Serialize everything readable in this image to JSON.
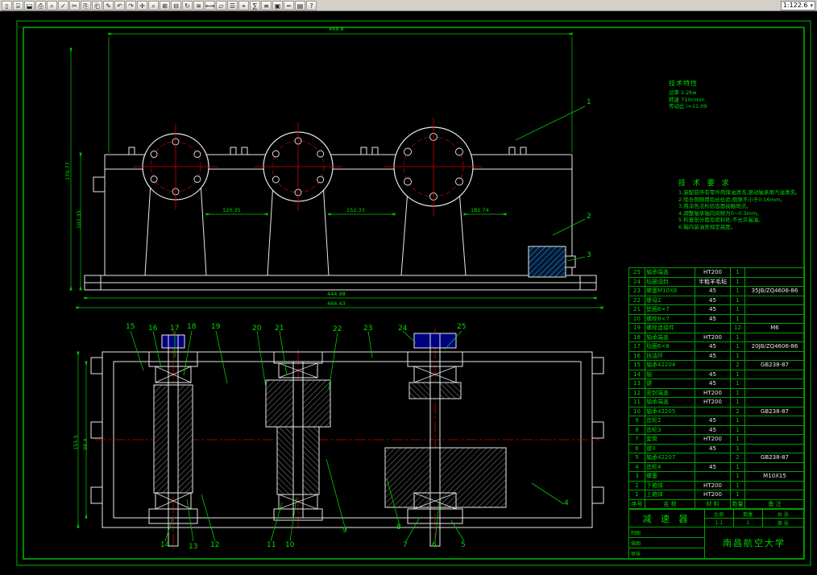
{
  "toolbar": {
    "zoom_value": "1:122.6",
    "icons": [
      {
        "name": "new",
        "glyph": "▯"
      },
      {
        "name": "open",
        "glyph": "⌸"
      },
      {
        "name": "save",
        "glyph": "⬓"
      },
      {
        "name": "print",
        "glyph": "⎙"
      },
      {
        "name": "print-preview",
        "glyph": "⌕"
      },
      {
        "name": "spell-check",
        "glyph": "✓"
      },
      {
        "name": "cut",
        "glyph": "✂"
      },
      {
        "name": "copy",
        "glyph": "⎘"
      },
      {
        "name": "paste",
        "glyph": "⎗"
      },
      {
        "name": "match-properties",
        "glyph": "✎"
      },
      {
        "name": "undo",
        "glyph": "↶"
      },
      {
        "name": "redo",
        "glyph": "↷"
      },
      {
        "name": "pan",
        "glyph": "✛"
      },
      {
        "name": "zoom-realtime",
        "glyph": "⌕"
      },
      {
        "name": "zoom-window",
        "glyph": "⊞"
      },
      {
        "name": "zoom-previous",
        "glyph": "⊟"
      },
      {
        "name": "redraw",
        "glyph": "↻"
      },
      {
        "name": "regen",
        "glyph": "≋"
      },
      {
        "name": "distance",
        "glyph": "⟷"
      },
      {
        "name": "area",
        "glyph": "▱"
      },
      {
        "name": "list",
        "glyph": "☰"
      },
      {
        "name": "id-point",
        "glyph": "⌖"
      },
      {
        "name": "calculator",
        "glyph": "∑"
      },
      {
        "name": "layers",
        "glyph": "≡"
      },
      {
        "name": "color-control",
        "glyph": "▣"
      },
      {
        "name": "linetype",
        "glyph": "╍"
      },
      {
        "name": "properties",
        "glyph": "▤"
      },
      {
        "name": "help",
        "glyph": "?"
      }
    ]
  },
  "tech_spec": {
    "title": "技术特性",
    "lines": [
      "功率 2.2kw",
      "转速 710r/min",
      "传动比 i=11.09"
    ]
  },
  "tech_req": {
    "title": "技 术 要 求",
    "lines": [
      "1.装配前所有零件用煤油清洗,滚动轴承用汽油清洗。",
      "2.啮合侧隙用铅丝检验,侧隙不小于0.16mm。",
      "3.用涂色法检验齿面接触斑点。",
      "4.调整轴承轴向间隙为0~0.3mm。",
      "5.检查剖分面及密封处,不允许漏油。",
      "6.箱内装油至规定高度。"
    ]
  },
  "bom": {
    "headers": [
      "序号",
      "名  称",
      "材  料",
      "数量",
      "备  注"
    ],
    "rows": [
      {
        "no": "25",
        "name": "轴承端盖",
        "mat": "HT200",
        "qty": "1",
        "note": ""
      },
      {
        "no": "24",
        "name": "毡圈油封",
        "mat": "半粗羊毛毡",
        "qty": "1",
        "note": ""
      },
      {
        "no": "23",
        "name": "螺塞M10X8",
        "mat": "45",
        "qty": "1",
        "note": "35JB/ZQ4606-86"
      },
      {
        "no": "22",
        "name": "螺母2",
        "mat": "45",
        "qty": "1",
        "note": ""
      },
      {
        "no": "21",
        "name": "垫圈8×7",
        "mat": "45",
        "qty": "1",
        "note": ""
      },
      {
        "no": "20",
        "name": "螺栓8×7",
        "mat": "45",
        "qty": "1",
        "note": ""
      },
      {
        "no": "19",
        "name": "螺栓连接件",
        "mat": "",
        "qty": "12",
        "note": "M6"
      },
      {
        "no": "18",
        "name": "轴承端盖",
        "mat": "HT200",
        "qty": "1",
        "note": ""
      },
      {
        "no": "17",
        "name": "毡圈6×6",
        "mat": "45",
        "qty": "1",
        "note": "20JB/ZQ4606-86"
      },
      {
        "no": "16",
        "name": "挡油环",
        "mat": "45",
        "qty": "1",
        "note": ""
      },
      {
        "no": "15",
        "name": "轴承42204",
        "mat": "",
        "qty": "2",
        "note": "GB238-87"
      },
      {
        "no": "14",
        "name": "轴",
        "mat": "45",
        "qty": "1",
        "note": ""
      },
      {
        "no": "13",
        "name": "键",
        "mat": "45",
        "qty": "1",
        "note": ""
      },
      {
        "no": "12",
        "name": "密封端盖",
        "mat": "HT200",
        "qty": "1",
        "note": ""
      },
      {
        "no": "11",
        "name": "轴承端盖",
        "mat": "HT200",
        "qty": "1",
        "note": ""
      },
      {
        "no": "10",
        "name": "轴承42205",
        "mat": "",
        "qty": "2",
        "note": "GB238-87"
      },
      {
        "no": "9",
        "name": "齿轮2",
        "mat": "45",
        "qty": "1",
        "note": ""
      },
      {
        "no": "8",
        "name": "齿轮3",
        "mat": "45",
        "qty": "1",
        "note": ""
      },
      {
        "no": "7",
        "name": "套筒",
        "mat": "HT200",
        "qty": "1",
        "note": ""
      },
      {
        "no": "6",
        "name": "键3",
        "mat": "45",
        "qty": "1",
        "note": ""
      },
      {
        "no": "5",
        "name": "轴承42207",
        "mat": "",
        "qty": "2",
        "note": "GB238-87"
      },
      {
        "no": "4",
        "name": "齿轮4",
        "mat": "45",
        "qty": "1",
        "note": ""
      },
      {
        "no": "3",
        "name": "螺塞",
        "mat": "",
        "qty": "1",
        "note": "M10X15"
      },
      {
        "no": "2",
        "name": "下箱体",
        "mat": "HT200",
        "qty": "1",
        "note": ""
      },
      {
        "no": "1",
        "name": "上箱体",
        "mat": "HT200",
        "qty": "1",
        "note": ""
      }
    ]
  },
  "title_block": {
    "part_name": "减 速 器",
    "scale_label": "比例",
    "scale_value": "1:1",
    "qty_label": "数量",
    "qty_value": "1",
    "sheet_label": "共 张",
    "sheet2_label": "第 张",
    "sign1": "制图",
    "sign2": "描图",
    "sign3": "审核",
    "school": "南昌航空大学"
  },
  "dims": {
    "top_width": "468.8",
    "mid1": "120.35",
    "mid2": "152.33",
    "mid3": "182.74",
    "bottom_inner": "444.98",
    "bottom_outer": "464.43",
    "left_height": "170.77",
    "left_height2": "102.35",
    "plan_left1": "155.5",
    "plan_left2": "98.4"
  },
  "callouts": {
    "c1": "1",
    "c2": "2",
    "c3": "3",
    "c4": "4",
    "c5": "5",
    "c6": "6",
    "c7": "7",
    "c8": "8",
    "c9": "9",
    "c10": "10",
    "c11": "11",
    "c12": "12",
    "c13": "13",
    "c14": "14",
    "c15": "15",
    "c16": "16",
    "c17": "17",
    "c18": "18",
    "c19": "19",
    "c20": "20",
    "c21": "21",
    "c22": "22",
    "c23": "23",
    "c24": "24",
    "c25": "25"
  }
}
